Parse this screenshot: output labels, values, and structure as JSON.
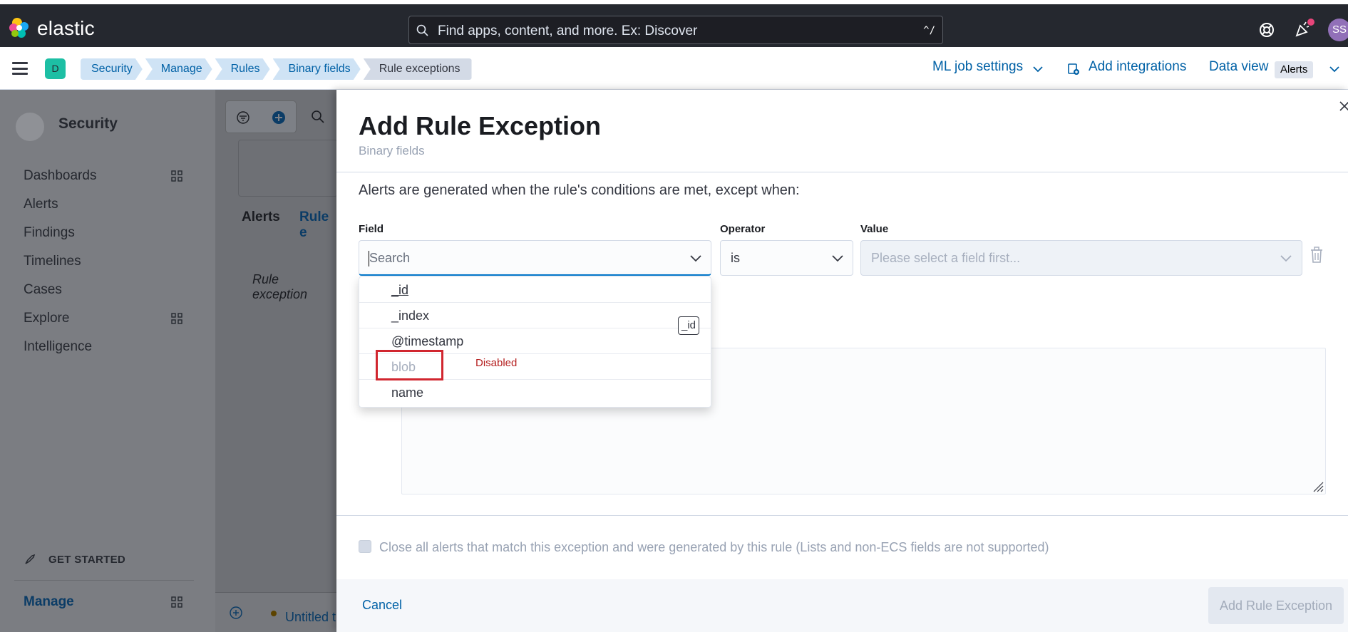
{
  "app": {
    "brand": "elastic"
  },
  "search": {
    "placeholder": "Find apps, content, and more. Ex: Discover",
    "shortcut": "^/"
  },
  "user": {
    "initials": "SS"
  },
  "space": {
    "badge": "D"
  },
  "breadcrumbs": [
    "Security",
    "Manage",
    "Rules",
    "Binary fields",
    "Rule exceptions"
  ],
  "header_actions": {
    "ml_job_settings": "ML job settings",
    "add_integrations": "Add integrations",
    "data_view": "Data view",
    "data_view_value": "Alerts"
  },
  "sidebar": {
    "title": "Security",
    "items": [
      "Dashboards",
      "Alerts",
      "Findings",
      "Timelines",
      "Cases",
      "Explore",
      "Intelligence"
    ],
    "get_started": "GET STARTED",
    "manage": "Manage"
  },
  "main": {
    "tab_alerts": "Alerts",
    "tab_rule": "Rule e",
    "rule_exceptions_text": "Rule exception",
    "timeline": "Untitled t"
  },
  "flyout": {
    "title": "Add Rule Exception",
    "subtitle": "Binary fields",
    "description": "Alerts are generated when the rule's conditions are met, except when:",
    "field_label": "Field",
    "field_placeholder": "Search",
    "operator_label": "Operator",
    "operator_value": "is",
    "value_label": "Value",
    "value_placeholder": "Please select a field first...",
    "field_options": [
      "_id",
      "_index",
      "@timestamp",
      "blob",
      "name"
    ],
    "tooltip": "_id",
    "disabled_annotation": "Disabled",
    "close_alerts_label": "Close all alerts that match this exception and were generated by this rule (Lists and non-ECS fields are not supported)",
    "cancel": "Cancel",
    "submit": "Add Rule Exception"
  },
  "colors": {
    "header_bg": "#25282f",
    "link": "#0061a6",
    "accent": "#0077cc",
    "highlight": "#d1262f"
  }
}
